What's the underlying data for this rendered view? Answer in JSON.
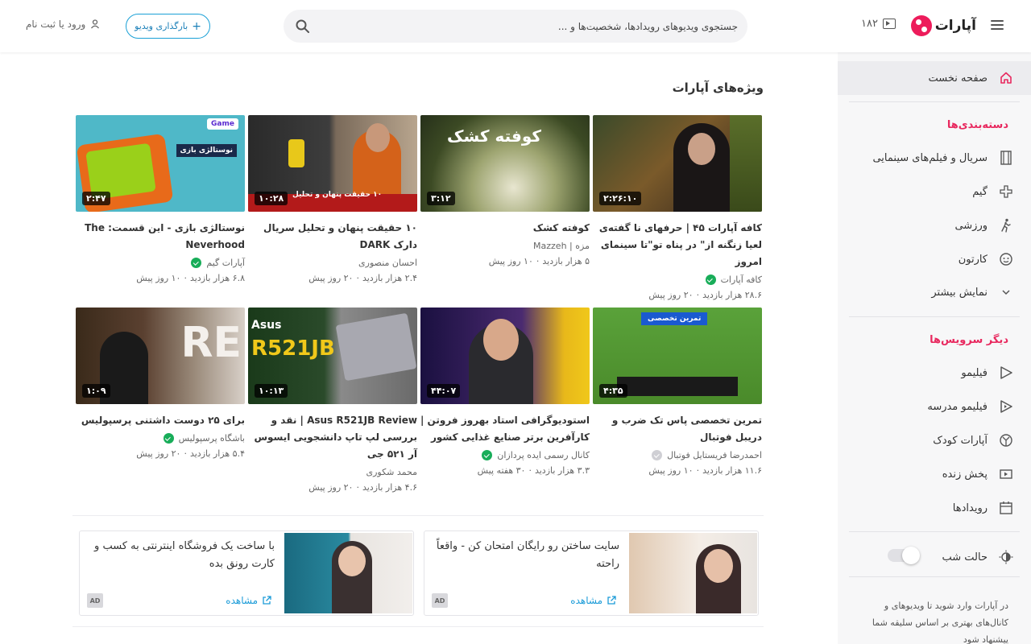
{
  "header": {
    "logo_text": "آپارات",
    "tv_count": "۱۸۲",
    "search_placeholder": "جستجوی ویدیوهای رویدادها، شخصیت‌ها و ...",
    "upload_label": "بارگذاری ویدیو",
    "login_label": "ورود یا ثبت نام"
  },
  "sidebar": {
    "home": "صفحه نخست",
    "categories_title": "دسته‌بندی‌ها",
    "categories": [
      "سریال و فیلم‌های سینمایی",
      "گیم",
      "ورزشی",
      "کارتون",
      "نمایش بیشتر"
    ],
    "services_title": "دیگر سرویس‌ها",
    "services": [
      "فیلیمو",
      "فیلیمو مدرسه",
      "آپارات کودک",
      "پخش زنده",
      "رویدادها"
    ],
    "night_mode": "حالت شب",
    "note": "در آپارات وارد شوید تا ویدیوهای و کانال‌های بهتری بر اساس سلیقه شما پیشنهاد شود"
  },
  "section_title": "ویژه‌های آپارات",
  "videos": [
    {
      "title": "کافه آپارات ۴۵ | حرفهای نا گفته‌ی لعیا زنگنه از\" در پناه تو\"تا سینمای امروز",
      "channel": "کافه آپارات",
      "verified": true,
      "views": "۲۸.۶ هزار بازدید",
      "ago": "۲۰ روز پیش",
      "duration": "۲:۲۶:۱۰",
      "thumb_text": ""
    },
    {
      "title": "کوفته کشک",
      "channel": "مزه | Mazzeh",
      "verified": false,
      "views": "۵ هزار بازدید",
      "ago": "۱۰ روز پیش",
      "duration": "۳:۱۲",
      "thumb_text": "کوفته کشک"
    },
    {
      "title": "۱۰ حقیقت پنهان و تحلیل سریال دارک DARK",
      "channel": "احسان منصوری",
      "verified": false,
      "views": "۲.۴ هزار بازدید",
      "ago": "۲۰ روز پیش",
      "duration": "۱۰:۲۸",
      "thumb_text": "۱۰ حقیقت پنهان و تحلیل"
    },
    {
      "title": "نوستالژی بازی - این قسمت: The Neverhood",
      "channel": "آپارات گیم",
      "verified": true,
      "views": "۶.۸ هزار بازدید",
      "ago": "۱۰ روز پیش",
      "duration": "۲:۴۷",
      "thumb_text": "نوستالژی بازی"
    },
    {
      "title": "تمرین تخصصی پاس تک ضرب و دریبل فوتبال",
      "channel": "احمدرضا فریستایل فوتبال",
      "verified": "grey",
      "views": "۱۱.۶ هزار بازدید",
      "ago": "۱۰ روز پیش",
      "duration": "۴:۳۵",
      "thumb_text": "تمرین تخصصی"
    },
    {
      "title": "استودیوگرافی استاد بهروز فروتن | کارآفرین برتر صنایع غذایی کشور",
      "channel": "کانال رسمی ایده پردازان",
      "verified": true,
      "views": "۳.۳ هزار بازدید",
      "ago": "۳۰ هفته پیش",
      "duration": "۴۴:۰۷",
      "thumb_text": ""
    },
    {
      "title": "Asus R521JB Review | نقد و بررسی لپ تاپ دانشجویی ایسوس آر ۵۲۱ جی",
      "channel": "محمد شکوری",
      "verified": false,
      "views": "۴.۶ هزار بازدید",
      "ago": "۲۰ روز پیش",
      "duration": "۱۰:۱۳",
      "thumb_text": "R521JB"
    },
    {
      "title": "برای ۲۵ دوست داشتنی پرسپولیس",
      "channel": "باشگاه پرسپولیس",
      "verified": true,
      "views": "۵.۴ هزار بازدید",
      "ago": "۲۰ روز پیش",
      "duration": "۱:۰۹",
      "thumb_text": "RE"
    }
  ],
  "ads": [
    {
      "title": "سایت ساختن رو رایگان امتحان کن - واقعاً راحته",
      "link": "مشاهده",
      "tag": "AD"
    },
    {
      "title": "با ساخت یک فروشگاه اینترنتی به کسب و کارت رونق بده",
      "link": "مشاهده",
      "tag": "AD"
    }
  ],
  "colors": {
    "brand": "#ed1c5b",
    "link": "#1a9bd8",
    "verified": "#18ad59"
  }
}
